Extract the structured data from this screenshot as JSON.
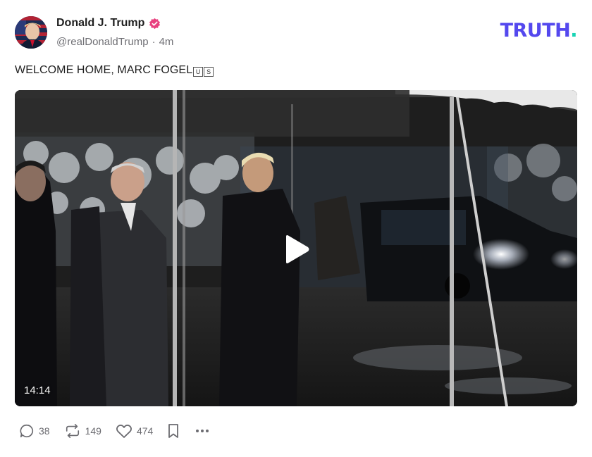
{
  "author": {
    "display_name": "Donald J. Trump",
    "handle": "@realDonaldTrump",
    "separator": "·",
    "time_ago": "4m",
    "verified": true
  },
  "brand": {
    "logo_text": "TRUTH",
    "logo_dot": ".",
    "colors": {
      "primary": "#5448ee",
      "accent": "#19d4b4",
      "verified": "#e8417f"
    }
  },
  "post": {
    "text": "WELCOME HOME, MARC FOGEL",
    "flag_letters": [
      "U",
      "S"
    ]
  },
  "video": {
    "duration": "14:14",
    "play_icon": "play-icon"
  },
  "actions": {
    "replies": "38",
    "retruths": "149",
    "likes": "474",
    "icons": [
      "reply-icon",
      "retruth-icon",
      "like-icon",
      "bookmark-icon",
      "more-icon"
    ]
  }
}
